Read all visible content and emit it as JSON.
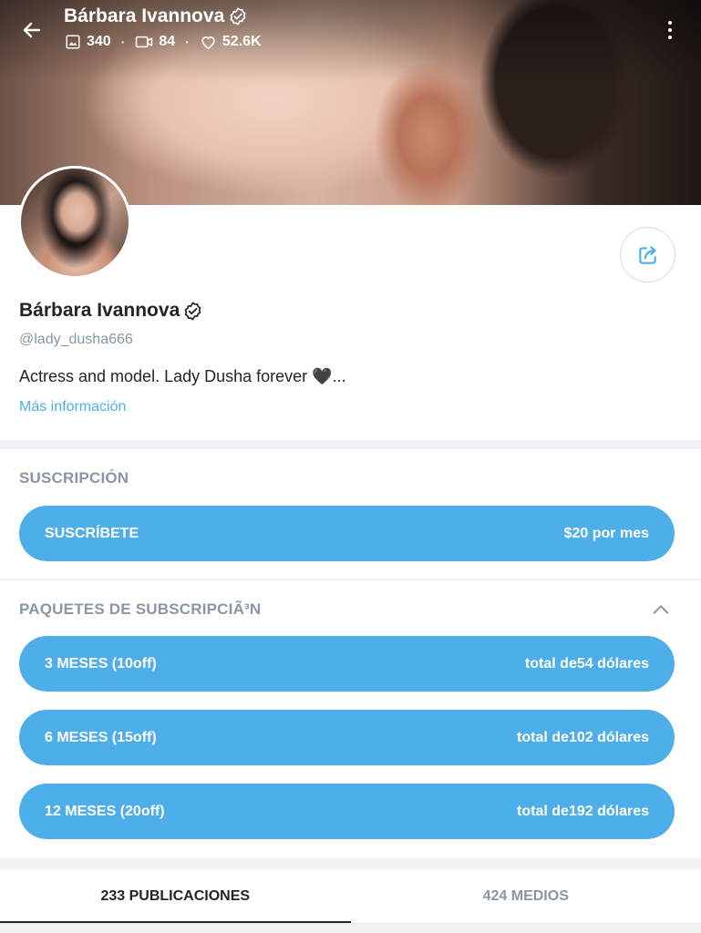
{
  "header": {
    "name": "Bárbara Ivannova",
    "photos_count": "340",
    "videos_count": "84",
    "likes_count": "52.6K",
    "separator": "·"
  },
  "profile": {
    "name": "Bárbara Ivannova",
    "handle": "@lady_dusha666",
    "bio": "Actress and model. Lady Dusha forever 🖤...",
    "more_info_label": "Más información"
  },
  "subscription": {
    "title": "SUSCRIPCIÓN",
    "button_label": "SUSCRÍBETE",
    "button_price": "$20 por mes"
  },
  "bundles": {
    "title": "PAQUETES DE SUBSCRIPCIÃ³N",
    "items": [
      {
        "label": "3 MESES (10off)",
        "price": "total de54 dólares"
      },
      {
        "label": "6 MESES (15off)",
        "price": "total de102 dólares"
      },
      {
        "label": "12 MESES (20off)",
        "price": "total de192 dólares"
      }
    ]
  },
  "tabs": [
    {
      "label": "233 PUBLICACIONES",
      "active": true
    },
    {
      "label": "424 MEDIOS",
      "active": false
    }
  ],
  "colors": {
    "accent": "#4eaeea",
    "link": "#4db0e7",
    "muted": "#8a96a3",
    "text": "#242529"
  },
  "icons": [
    "back-arrow-icon",
    "image-icon",
    "video-icon",
    "heart-icon",
    "verified-icon",
    "more-vertical-icon",
    "share-icon",
    "chevron-up-icon"
  ]
}
